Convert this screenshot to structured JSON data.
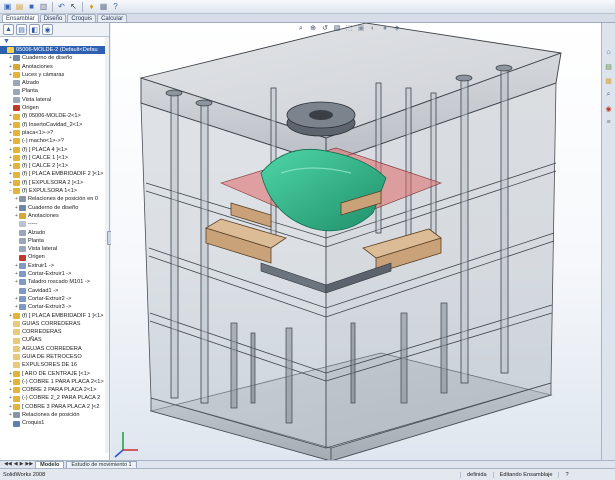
{
  "toolbar": {
    "buttons": [
      {
        "name": "new-icon",
        "glyph": "▣",
        "color": "#3a66b5"
      },
      {
        "name": "open-icon",
        "glyph": "▤",
        "color": "#d9a23a"
      },
      {
        "name": "save-icon",
        "glyph": "■",
        "color": "#3a66b5"
      },
      {
        "name": "print-icon",
        "glyph": "▥",
        "color": "#6b7a90"
      },
      {
        "name": "undo-icon",
        "glyph": "↶",
        "color": "#3a66b5"
      },
      {
        "name": "select-icon",
        "glyph": "↖",
        "color": "#333333"
      },
      {
        "name": "rebuild-icon",
        "glyph": "♦",
        "color": "#d0a020"
      },
      {
        "name": "options-icon",
        "glyph": "▦",
        "color": "#6b7a90"
      },
      {
        "name": "help-icon",
        "glyph": "?",
        "color": "#3a66b5"
      }
    ]
  },
  "command_tabs": [
    "Ensamblar",
    "Diseño",
    "Croquis",
    "Calcular"
  ],
  "feature_tree": {
    "rows": [
      {
        "text": "05006-MOLDE-2 (Default<Defau",
        "indent": 0,
        "toggle": "",
        "icon": "#e8c04a",
        "selected": true
      },
      {
        "text": "Cuaderno de diseño",
        "indent": 1,
        "toggle": "+",
        "icon": "#6f86a8"
      },
      {
        "text": "Anotaciones",
        "indent": 1,
        "toggle": "+",
        "icon": "#d4a93a"
      },
      {
        "text": "Luces y cámaras",
        "indent": 1,
        "toggle": "+",
        "icon": "#e2b43c"
      },
      {
        "text": "Alzado",
        "indent": 1,
        "toggle": "",
        "icon": "#9aa7b8"
      },
      {
        "text": "Planta",
        "indent": 1,
        "toggle": "",
        "icon": "#9aa7b8"
      },
      {
        "text": "Vista lateral",
        "indent": 1,
        "toggle": "",
        "icon": "#9aa7b8"
      },
      {
        "text": "Origen",
        "indent": 1,
        "toggle": "",
        "icon": "#c0392b"
      },
      {
        "text": "(f) 05006-MOLDE-2<1>",
        "indent": 1,
        "toggle": "+",
        "icon": "#e2b43c"
      },
      {
        "text": "(f) InsertoCavidad_2<1>",
        "indent": 1,
        "toggle": "+",
        "icon": "#e2b43c"
      },
      {
        "text": "placa<1>->?",
        "indent": 1,
        "toggle": "+",
        "icon": "#e2b43c"
      },
      {
        "text": "(-) macho<1>->?",
        "indent": 1,
        "toggle": "+",
        "icon": "#e2b43c"
      },
      {
        "text": "(f) [ PLACA 4 ]<1>",
        "indent": 1,
        "toggle": "+",
        "icon": "#e2b43c"
      },
      {
        "text": "(f) [ CALCE 1 ]<1>",
        "indent": 1,
        "toggle": "+",
        "icon": "#e2b43c"
      },
      {
        "text": "(f) [ CALCE 2 ]<1>",
        "indent": 1,
        "toggle": "+",
        "icon": "#e2b43c"
      },
      {
        "text": "(f) [ PLACA EMBRIDADIF 2 ]<1>",
        "indent": 1,
        "toggle": "+",
        "icon": "#e2b43c"
      },
      {
        "text": "(f) [ EXPULSORA 2 ]<1>",
        "indent": 1,
        "toggle": "+",
        "icon": "#e2b43c"
      },
      {
        "text": "(f) EXPULSORA 1<1>",
        "indent": 1,
        "toggle": "−",
        "icon": "#e2b43c"
      },
      {
        "text": "Relaciones de posición en 0",
        "indent": 2,
        "toggle": "+",
        "icon": "#8a96a8"
      },
      {
        "text": "Cuaderno de diseño",
        "indent": 2,
        "toggle": "+",
        "icon": "#6f86a8"
      },
      {
        "text": "Anotaciones",
        "indent": 2,
        "toggle": "+",
        "icon": "#d4a93a"
      },
      {
        "text": "-----",
        "indent": 2,
        "toggle": "",
        "icon": "#b9c2d0"
      },
      {
        "text": "Alzado",
        "indent": 2,
        "toggle": "",
        "icon": "#9aa7b8"
      },
      {
        "text": "Planta",
        "indent": 2,
        "toggle": "",
        "icon": "#9aa7b8"
      },
      {
        "text": "Vista lateral",
        "indent": 2,
        "toggle": "",
        "icon": "#9aa7b8"
      },
      {
        "text": "Origen",
        "indent": 2,
        "toggle": "",
        "icon": "#c0392b"
      },
      {
        "text": "Extruir1 ->",
        "indent": 2,
        "toggle": "+",
        "icon": "#7f9bbf"
      },
      {
        "text": "Cortar-Extruir1 ->",
        "indent": 2,
        "toggle": "+",
        "icon": "#7f9bbf"
      },
      {
        "text": "Taladro roscado M101 ->",
        "indent": 2,
        "toggle": "+",
        "icon": "#7f9bbf"
      },
      {
        "text": "Cavidad1 ->",
        "indent": 2,
        "toggle": "",
        "icon": "#7f9bbf"
      },
      {
        "text": "Cortar-Extruir2 ->",
        "indent": 2,
        "toggle": "+",
        "icon": "#7f9bbf"
      },
      {
        "text": "Cortar-Extruir3 ->",
        "indent": 2,
        "toggle": "+",
        "icon": "#7f9bbf"
      },
      {
        "text": "(f) [ PLACA EMBRIDADIF 1 ]<1>",
        "indent": 1,
        "toggle": "+",
        "icon": "#e2b43c"
      },
      {
        "text": "GUIAS CORREDERAS",
        "indent": 1,
        "toggle": "",
        "icon": "#e8c87a"
      },
      {
        "text": "CORREDERAS",
        "indent": 1,
        "toggle": "",
        "icon": "#e8c87a"
      },
      {
        "text": "CUÑAS",
        "indent": 1,
        "toggle": "",
        "icon": "#e8c87a"
      },
      {
        "text": "AGUJAS CORREDERA",
        "indent": 1,
        "toggle": "",
        "icon": "#e8c87a"
      },
      {
        "text": "GUIA DE RETROCESO",
        "indent": 1,
        "toggle": "",
        "icon": "#e8c87a"
      },
      {
        "text": "EXPULSORES DE 16",
        "indent": 1,
        "toggle": "",
        "icon": "#e8c87a"
      },
      {
        "text": "[ ARO DE CENTRAJE ]<1>",
        "indent": 1,
        "toggle": "+",
        "icon": "#e2b43c"
      },
      {
        "text": "(-) COBRE 1 PARA PLACA 2<1>",
        "indent": 1,
        "toggle": "+",
        "icon": "#e2b43c"
      },
      {
        "text": "COBRE 2 PARA PLACA 2<1>",
        "indent": 1,
        "toggle": "+",
        "icon": "#e2b43c"
      },
      {
        "text": "(-) COBRE 2_2 PARA PLACA 2",
        "indent": 1,
        "toggle": "+",
        "icon": "#e2b43c"
      },
      {
        "text": "[ COBRE 3 PARA PLACA 2 ]<2",
        "indent": 1,
        "toggle": "+",
        "icon": "#e2b43c"
      },
      {
        "text": "Relaciones de posición",
        "indent": 1,
        "toggle": "+",
        "icon": "#8a96a8"
      },
      {
        "text": "Croquis1",
        "indent": 1,
        "toggle": "",
        "icon": "#5f7fb0"
      }
    ]
  },
  "bottom_tabs": [
    "Modelo",
    "Estudio de movimiento 1"
  ],
  "status": {
    "app": "SolidWorks 2008",
    "state": "definida",
    "mode": "Editando Ensamblaje",
    "help": "?"
  },
  "view_toolbar": [
    {
      "name": "zoom-to-fit-icon",
      "glyph": "⌕"
    },
    {
      "name": "zoom-area-icon",
      "glyph": "⊕"
    },
    {
      "name": "previous-view-icon",
      "glyph": "↺"
    },
    {
      "name": "section-view-icon",
      "glyph": "▧"
    },
    {
      "name": "view-orientation-icon",
      "glyph": "⬚"
    },
    {
      "name": "display-style-icon",
      "glyph": "▣"
    },
    {
      "name": "hide-show-icon",
      "glyph": "◐"
    },
    {
      "name": "appearance-icon",
      "glyph": "●"
    },
    {
      "name": "scene-icon",
      "glyph": "◈"
    }
  ],
  "task_pane": [
    {
      "name": "resources-icon",
      "glyph": "⌂",
      "color": "#3a66b5"
    },
    {
      "name": "design-library-icon",
      "glyph": "▤",
      "color": "#5a8a3a"
    },
    {
      "name": "file-explorer-icon",
      "glyph": "▦",
      "color": "#d9a23a"
    },
    {
      "name": "search-icon",
      "glyph": "⌕",
      "color": "#3a66b5"
    },
    {
      "name": "appearances-icon",
      "glyph": "◉",
      "color": "#c0392b"
    },
    {
      "name": "custom-properties-icon",
      "glyph": "≡",
      "color": "#6b7a90"
    }
  ],
  "colors": {
    "mold_plate": "#9aa3ad",
    "cavity_green": "#2fb58a",
    "slide_brown": "#c9a27a",
    "insert_red": "#e06a6a",
    "selection_blue": "#2f5fb0"
  }
}
